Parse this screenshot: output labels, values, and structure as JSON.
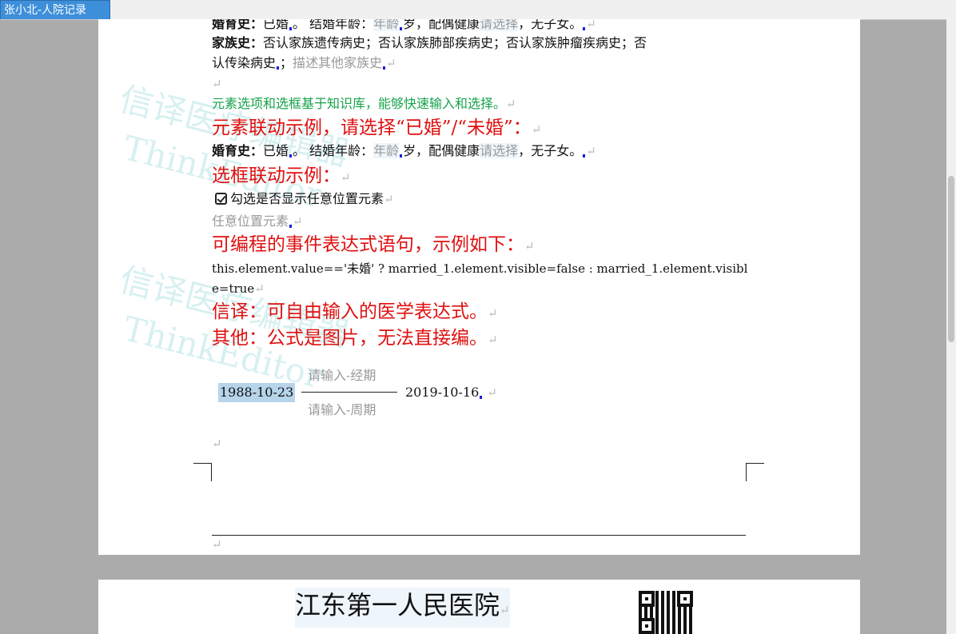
{
  "tab": {
    "title": "张小北-人院记录"
  },
  "watermark": {
    "line1": "信译医疗编辑器",
    "line2": "ThinkEditor"
  },
  "doc": {
    "marital_top": {
      "label": "婚育史：",
      "value": "已婚",
      "age_label": "结婚年龄：",
      "age_ph": "年龄",
      "text1": "岁，配偶健康",
      "spouse_ph": "请选择",
      "text2": "，无子女。"
    },
    "family": {
      "label": "家族史：",
      "text1": "否认家族遗传病史；否认家族肺部疾病史；否认家族肿瘤疾病史；否",
      "text2": "认传染病史",
      "sep": "；",
      "desc_ph": "描述其他家族史"
    },
    "note_green": "元素选项和选框基于知识库，能够快速输入和选择。",
    "demo_link": "元素联动示例，请选择“已婚”/“未婚”：",
    "marital_bottom": {
      "label": "婚育史：",
      "value": "已婚",
      "age_label": "结婚年龄：",
      "age_ph": "年龄",
      "text1": "岁，配偶健康",
      "spouse_ph": "请选择",
      "text2": "，无子女。"
    },
    "box_demo": "选框联动示例：",
    "checkbox_label": "勾选是否显示任意位置元素",
    "any_pos": "任意位置元素",
    "event_title": "可编程的事件表达式语句，示例如下：",
    "code_line1": "this.element.value=='未婚' ? married_1.element.visible=false : married_1.element.visibl",
    "code_line2": "e=true",
    "xinyi": "信译：可自由输入的医学表达式。",
    "other": "其他：公式是图片，无法直接编。",
    "formula": {
      "start": "1988-10-23",
      "top_ph": "请输入-经期",
      "bottom_ph": "请输入-周期",
      "end": "2019-10-16"
    }
  },
  "page2": {
    "hospital": "江东第一人民医院"
  },
  "qr": {
    "icon": "qr-code-icon"
  }
}
